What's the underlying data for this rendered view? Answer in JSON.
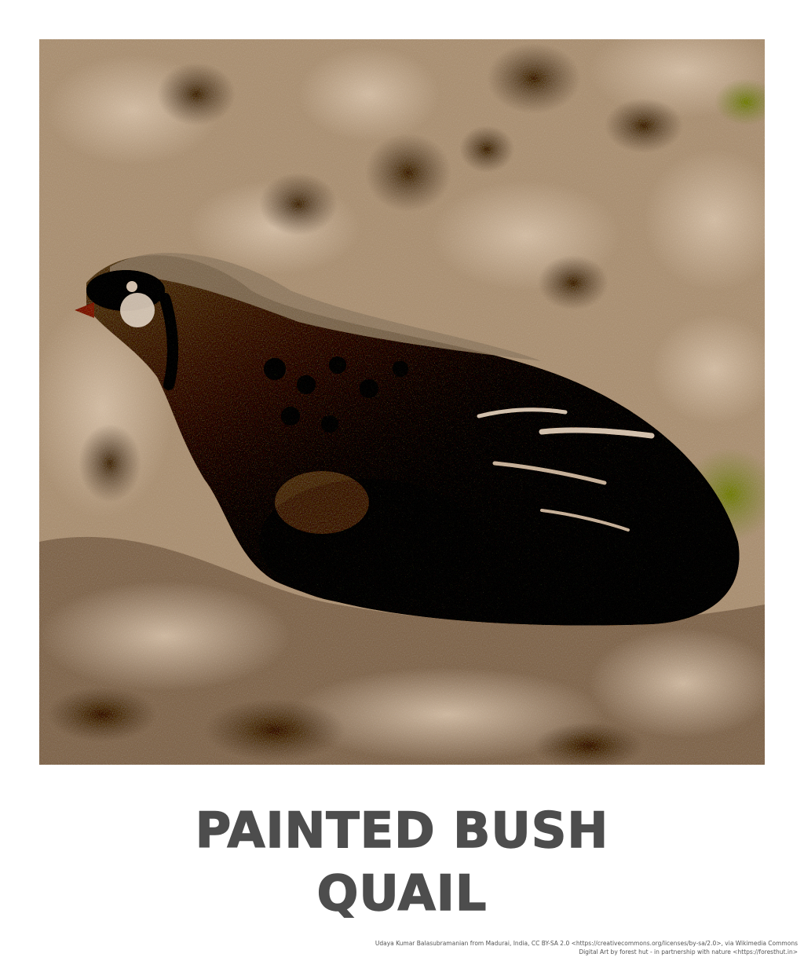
{
  "poster": {
    "title_line1": "PAINTED BUSH",
    "title_line2": "QUAIL",
    "credit_line1": "Udaya Kumar Balasubramanian from Madurai, India, CC BY-SA 2.0 <https://creativecommons.org/licenses/by-sa/2.0>, via Wikimedia Commons",
    "credit_line2": "Digital Art by  forest hut - in partnership with nature <https://foresthut.in>"
  },
  "artwork": {
    "subject": "painted-bush-quail-illustration",
    "colors": {
      "background": "#b49d84",
      "bird_dark": "#2e241c",
      "bird_mid": "#5a4a3c",
      "highlight": "#d9c8b6",
      "moss": "#7d8a3c"
    }
  },
  "colors": {
    "title": "#4d4d4d",
    "credit": "#555555",
    "page": "#ffffff"
  }
}
